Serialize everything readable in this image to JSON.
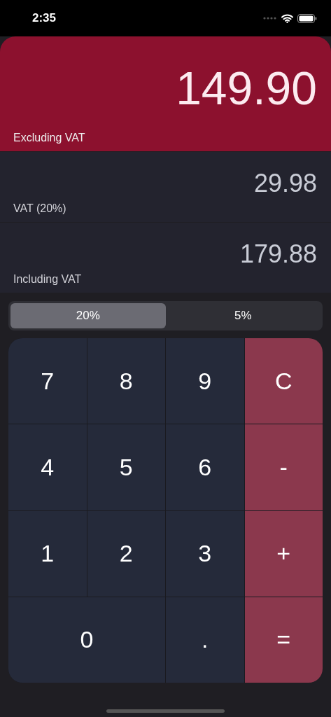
{
  "status_bar": {
    "time": "2:35"
  },
  "results": [
    {
      "kind": "primary",
      "value": "149.90",
      "label": "Excluding VAT"
    },
    {
      "kind": "secondary",
      "value": "29.98",
      "label": "VAT (20%)"
    },
    {
      "kind": "secondary",
      "value": "179.88",
      "label": "Including VAT"
    }
  ],
  "rate_tabs": [
    {
      "label": "20%",
      "selected": true
    },
    {
      "label": "5%",
      "selected": false
    }
  ],
  "keys": [
    {
      "label": "7",
      "kind": "digit"
    },
    {
      "label": "8",
      "kind": "digit"
    },
    {
      "label": "9",
      "kind": "digit"
    },
    {
      "label": "C",
      "kind": "operator"
    },
    {
      "label": "4",
      "kind": "digit"
    },
    {
      "label": "5",
      "kind": "digit"
    },
    {
      "label": "6",
      "kind": "digit"
    },
    {
      "label": "-",
      "kind": "operator"
    },
    {
      "label": "1",
      "kind": "digit"
    },
    {
      "label": "2",
      "kind": "digit"
    },
    {
      "label": "3",
      "kind": "digit"
    },
    {
      "label": "+",
      "kind": "operator"
    },
    {
      "label": "0",
      "kind": "wide"
    },
    {
      "label": ".",
      "kind": "digit"
    },
    {
      "label": "=",
      "kind": "operator"
    }
  ]
}
